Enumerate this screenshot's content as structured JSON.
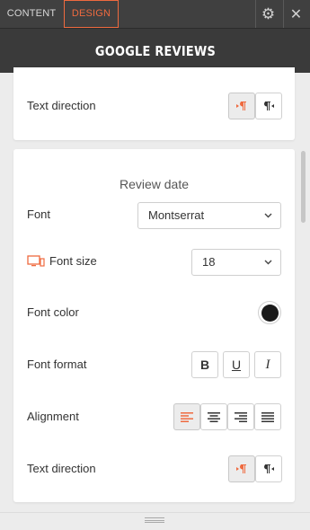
{
  "tabs": {
    "content": "CONTENT",
    "design": "DESIGN"
  },
  "icons": {
    "settings": "gear-icon",
    "close": "close-icon"
  },
  "panel_title": "GOOGLE REVIEWS",
  "card1": {
    "text_direction_label": "Text direction",
    "rtl_glyph": "⁋",
    "ltr_glyph": "¶"
  },
  "card2": {
    "section_title": "Review date",
    "font_label": "Font",
    "font_value": "Montserrat",
    "font_size_label": "Font size",
    "font_size_value": "18",
    "font_color_label": "Font color",
    "font_color": "#1a1a1a",
    "font_format_label": "Font format",
    "format_buttons": {
      "bold": "B",
      "underline": "U",
      "italic": "I"
    },
    "alignment_label": "Alignment",
    "alignment_selected": "left",
    "text_direction_label": "Text direction"
  },
  "accent_color": "#ef6a3f",
  "chevron": "⌄"
}
